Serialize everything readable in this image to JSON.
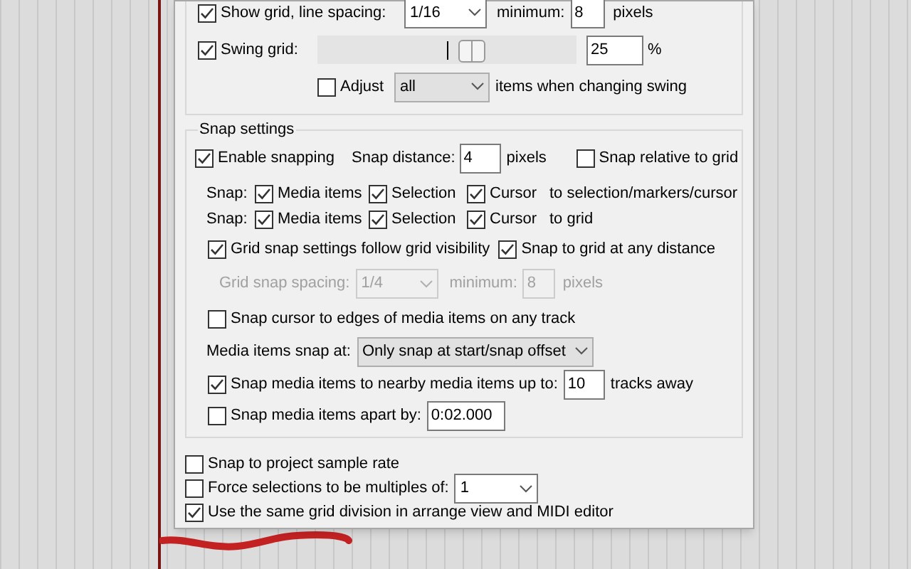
{
  "grid_section": {
    "show_grid": {
      "label": "Show grid, line spacing:",
      "checked": true
    },
    "line_spacing": {
      "value": "1/16",
      "kind": "editable"
    },
    "minimum_label": "minimum:",
    "minimum": "8",
    "pixels_label": "pixels",
    "swing_grid": {
      "label": "Swing grid:",
      "checked": true
    },
    "swing_slider": {
      "level": 0.61
    },
    "swing_value": "25",
    "percent_label": "%",
    "adjust": {
      "label": "Adjust",
      "checked": false
    },
    "adjust_select": {
      "value": "all",
      "kind": "list"
    },
    "adjust_suffix": "items when changing swing"
  },
  "snap_settings": {
    "title": "Snap settings",
    "enable_snapping": {
      "label": "Enable snapping",
      "checked": true
    },
    "snap_distance_label": "Snap distance:",
    "snap_distance": "4",
    "pixels_label": "pixels",
    "snap_relative": {
      "label": "Snap relative to grid",
      "checked": false
    },
    "snap_rows": [
      {
        "label": "Snap:",
        "options": [
          {
            "label": "Media items",
            "checked": true
          },
          {
            "label": "Selection",
            "checked": true
          },
          {
            "label": "Cursor",
            "checked": true
          }
        ],
        "suffix": "to selection/markers/cursor"
      },
      {
        "label": "Snap:",
        "options": [
          {
            "label": "Media items",
            "checked": true
          },
          {
            "label": "Selection",
            "checked": true
          },
          {
            "label": "Cursor",
            "checked": true
          }
        ],
        "suffix": "to grid"
      }
    ],
    "grid_follow": {
      "label": "Grid snap settings follow grid visibility",
      "checked": true
    },
    "snap_any_distance": {
      "label": "Snap to grid at any distance",
      "checked": true
    },
    "grid_snap_spacing": {
      "label": "Grid snap spacing:",
      "value": "1/4",
      "minimum_label": "minimum:",
      "minimum": "8",
      "pixels_label": "pixels",
      "disabled": true
    },
    "snap_cursor_edges": {
      "label": "Snap cursor to edges of media items on any track",
      "checked": false
    },
    "media_snap_at": {
      "label": "Media items snap at:",
      "value": "Only snap at start/snap offset",
      "kind": "list"
    },
    "snap_nearby": {
      "label": "Snap media items to nearby media items up to:",
      "checked": true,
      "value": "10",
      "suffix": "tracks away"
    },
    "snap_apart": {
      "label": "Snap media items apart by:",
      "checked": false,
      "value": "0:02.000"
    }
  },
  "bottom_options": [
    {
      "label": "Snap to project sample rate",
      "checked": false
    },
    {
      "label": "Force selections to be multiples of:",
      "checked": false,
      "select": "1"
    },
    {
      "label": "Use the same grid division in arrange view and MIDI editor",
      "checked": true
    }
  ]
}
